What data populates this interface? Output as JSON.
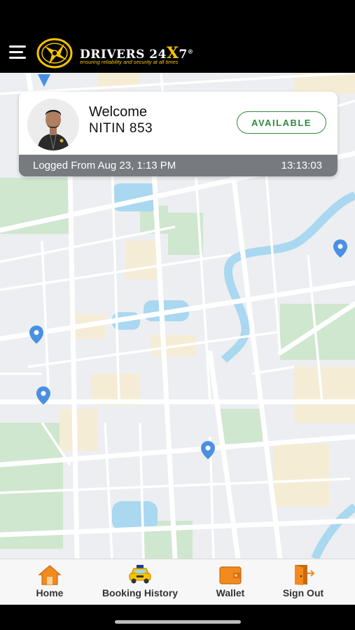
{
  "header": {
    "brand_name": "DRIVERS 24",
    "brand_accent": "X",
    "brand_suffix": "7",
    "brand_mark": "®",
    "tagline": "ensuring reliability and security at all times"
  },
  "driver_card": {
    "greeting": "Welcome",
    "driver_name": "NITIN 853",
    "status_label": "AVAILABLE",
    "logged_from": "Logged From Aug 23, 1:13 PM",
    "timer": "13:13:03"
  },
  "bottom_nav": {
    "items": [
      {
        "label": "Home",
        "icon": "home-icon"
      },
      {
        "label": "Booking History",
        "icon": "taxi-icon"
      },
      {
        "label": "Wallet",
        "icon": "wallet-icon"
      },
      {
        "label": "Sign Out",
        "icon": "sign-out-door-icon"
      }
    ]
  },
  "colors": {
    "header_bg": "#000000",
    "brand_yellow": "#f6c400",
    "status_green": "#2e8b3d",
    "nav_orange": "#f28a1e",
    "map_bg": "#eceef1",
    "map_pin": "#4a90e2"
  }
}
